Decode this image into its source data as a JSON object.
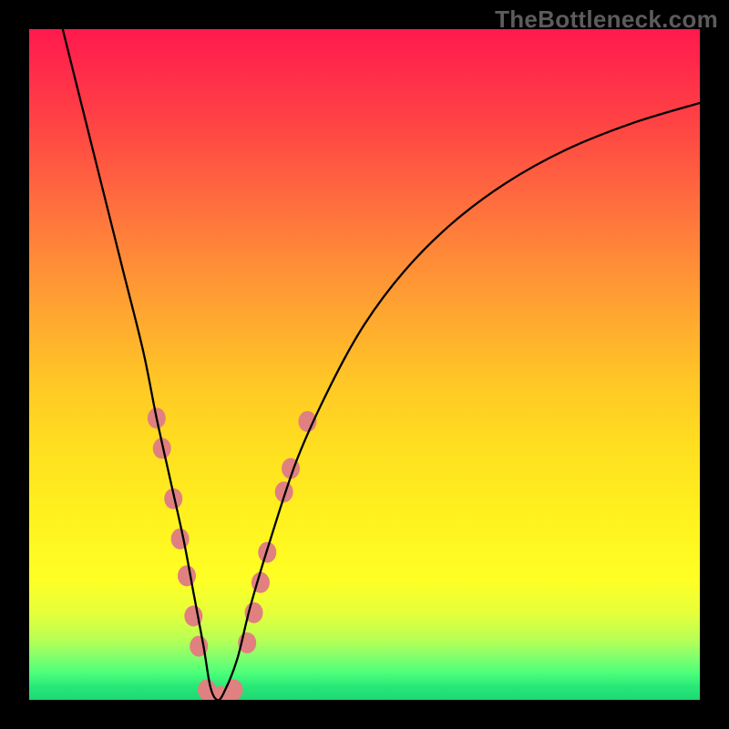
{
  "watermark": "TheBottleneck.com",
  "chart_data": {
    "type": "line",
    "title": "",
    "xlabel": "",
    "ylabel": "",
    "xlim": [
      0,
      100
    ],
    "ylim": [
      0,
      100
    ],
    "series": [
      {
        "name": "bottleneck-curve",
        "x": [
          5,
          8,
          11,
          14,
          17,
          19,
          21,
          23,
          24.5,
          26,
          27,
          28,
          29,
          31,
          33,
          36,
          40,
          45,
          50,
          56,
          63,
          71,
          80,
          90,
          100
        ],
        "y": [
          100,
          88,
          76,
          64,
          52,
          42,
          33,
          24,
          16,
          8,
          2,
          0,
          1,
          6,
          14,
          24,
          36,
          47,
          56,
          64,
          71,
          77,
          82,
          86,
          89
        ]
      }
    ],
    "markers": {
      "name": "curve-beads",
      "color": "#e08080",
      "radius_px": 10,
      "points": [
        {
          "x": 19.0,
          "y": 42.0
        },
        {
          "x": 19.8,
          "y": 37.5
        },
        {
          "x": 21.5,
          "y": 30.0
        },
        {
          "x": 22.5,
          "y": 24.0
        },
        {
          "x": 23.5,
          "y": 18.5
        },
        {
          "x": 24.5,
          "y": 12.5
        },
        {
          "x": 25.3,
          "y": 8.0
        },
        {
          "x": 26.5,
          "y": 1.5
        },
        {
          "x": 28.5,
          "y": 0.5
        },
        {
          "x": 30.5,
          "y": 1.5
        },
        {
          "x": 32.5,
          "y": 8.5
        },
        {
          "x": 33.5,
          "y": 13.0
        },
        {
          "x": 34.5,
          "y": 17.5
        },
        {
          "x": 35.5,
          "y": 22.0
        },
        {
          "x": 38.0,
          "y": 31.0
        },
        {
          "x": 39.0,
          "y": 34.5
        },
        {
          "x": 41.5,
          "y": 41.5
        }
      ]
    }
  }
}
